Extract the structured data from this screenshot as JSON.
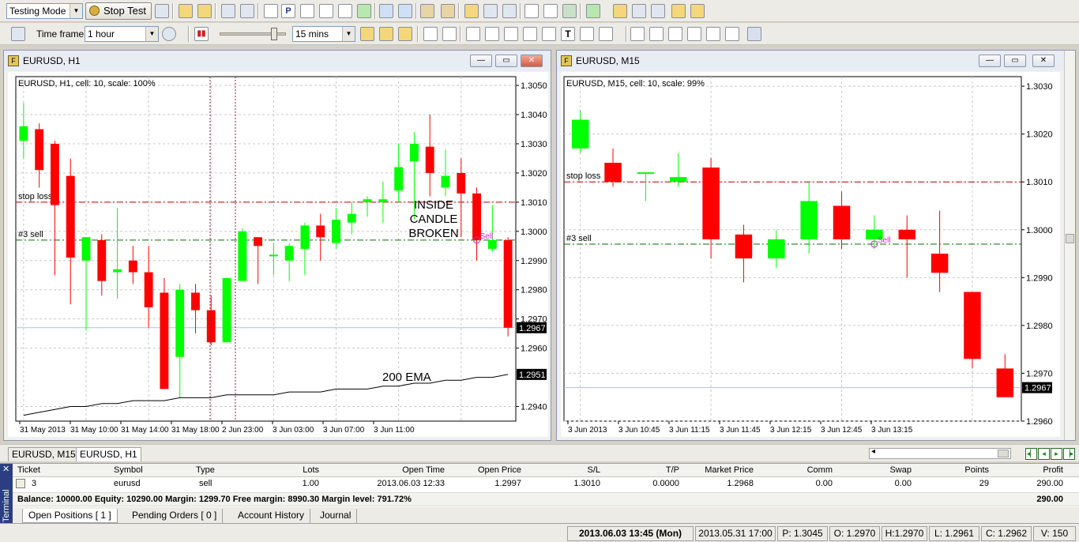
{
  "toolbar": {
    "mode_select": "Testing Mode",
    "stop_test_label": "Stop Test",
    "timeframe_label": "Time frame:",
    "timeframe_value": "1 hour",
    "speed_value": "15 mins"
  },
  "charts": [
    {
      "title": "EURUSD, H1",
      "info": "EURUSD, H1, cell: 10, scale: 100%",
      "y_ticks": [
        "1.3050",
        "1.3040",
        "1.3030",
        "1.3020",
        "1.3010",
        "1.3000",
        "1.2990",
        "1.2980",
        "1.2970",
        "1.2960",
        "1.2940"
      ],
      "x_ticks": [
        "31 May 2013",
        "31 May 10:00",
        "31 May 14:00",
        "31 May 18:00",
        "2 Jun 23:00",
        "3 Jun 03:00",
        "3 Jun 07:00",
        "3 Jun 11:00"
      ],
      "price_label": "1.2967",
      "ema_label": "1.2951",
      "stop_loss_label": "stop loss",
      "order_label": "#3 sell",
      "sell_marker": "Sell",
      "annotation_1": "INSIDE",
      "annotation_2": "CANDLE",
      "annotation_3": "BROKEN",
      "ema_text": "200 EMA"
    },
    {
      "title": "EURUSD, M15",
      "info": "EURUSD, M15, cell: 10, scale: 99%",
      "y_ticks": [
        "1.3030",
        "1.3020",
        "1.3010",
        "1.3000",
        "1.2990",
        "1.2980",
        "1.2970",
        "1.2960"
      ],
      "x_ticks": [
        "3 Jun 2013",
        "3 Jun 10:45",
        "3 Jun 11:15",
        "3 Jun 11:45",
        "3 Jun 12:15",
        "3 Jun 12:45",
        "3 Jun 13:15"
      ],
      "price_label": "1.2967",
      "stop_loss_label": "stop loss",
      "order_label": "#3 sell",
      "sell_marker": "Sell"
    }
  ],
  "chart_data": [
    {
      "type": "candlestick",
      "title": "EURUSD, H1",
      "ylim": [
        1.2935,
        1.3053
      ],
      "series": [
        {
          "name": "EURUSD H1",
          "candles": [
            [
              1.3031,
              1.3044,
              1.3025,
              1.3036
            ],
            [
              1.3035,
              1.3037,
              1.3015,
              1.3021
            ],
            [
              1.303,
              1.3031,
              1.2985,
              1.3009
            ],
            [
              1.3019,
              1.3025,
              1.2975,
              1.2991
            ],
            [
              1.299,
              1.2998,
              1.2966,
              1.2998
            ],
            [
              1.2997,
              1.2999,
              1.2978,
              1.2983
            ],
            [
              1.2986,
              1.3008,
              1.2977,
              1.2987
            ],
            [
              1.299,
              1.2995,
              1.2982,
              1.2986
            ],
            [
              1.2986,
              1.2995,
              1.2967,
              1.2974
            ],
            [
              1.2979,
              1.2984,
              1.296,
              1.2946
            ],
            [
              1.2957,
              1.2982,
              1.2943,
              1.298
            ],
            [
              1.2979,
              1.2982,
              1.2965,
              1.2973
            ],
            [
              1.2973,
              1.2978,
              1.2961,
              1.2962
            ],
            [
              1.2962,
              1.2982,
              1.2962,
              1.2984
            ],
            [
              1.2983,
              1.3001,
              1.2983,
              1.3
            ],
            [
              1.2998,
              1.2998,
              1.2982,
              1.2995
            ],
            [
              1.2992,
              1.2996,
              1.2985,
              1.2992
            ],
            [
              1.299,
              1.2996,
              1.2983,
              1.2995
            ],
            [
              1.2994,
              1.3003,
              1.2985,
              1.3002
            ],
            [
              1.3002,
              1.3006,
              1.299,
              1.2998
            ],
            [
              1.2996,
              1.3008,
              1.2994,
              1.3004
            ],
            [
              1.3003,
              1.301,
              1.2999,
              1.3006
            ],
            [
              1.301,
              1.3012,
              1.3005,
              1.3011
            ],
            [
              1.301,
              1.3017,
              1.3003,
              1.3011
            ],
            [
              1.3014,
              1.303,
              1.301,
              1.3022
            ],
            [
              1.3024,
              1.3034,
              1.3004,
              1.303
            ],
            [
              1.3029,
              1.304,
              1.3012,
              1.302
            ],
            [
              1.3015,
              1.3028,
              1.3012,
              1.3019
            ],
            [
              1.302,
              1.3025,
              1.2998,
              1.3013
            ],
            [
              1.3013,
              1.3015,
              1.299,
              1.2997
            ],
            [
              1.2994,
              1.3009,
              1.2993,
              1.2997
            ],
            [
              1.2997,
              1.2998,
              1.2964,
              1.2967
            ]
          ]
        }
      ],
      "ema": [
        1.2937,
        1.2938,
        1.2939,
        1.294,
        1.294,
        1.2941,
        1.2941,
        1.2942,
        1.2942,
        1.2942,
        1.2943,
        1.2943,
        1.2943,
        1.2944,
        1.2944,
        1.2944,
        1.2944,
        1.2945,
        1.2945,
        1.2945,
        1.2946,
        1.2946,
        1.2946,
        1.2947,
        1.2947,
        1.2948,
        1.2948,
        1.2949,
        1.2949,
        1.295,
        1.295,
        1.2951
      ],
      "stop_loss": 1.301,
      "order_price": 1.2997,
      "current_price": 1.2967
    },
    {
      "type": "candlestick",
      "title": "EURUSD, M15",
      "ylim": [
        1.296,
        1.3032
      ],
      "series": [
        {
          "name": "EURUSD M15",
          "candles": [
            [
              1.3017,
              1.3025,
              1.3016,
              1.3023
            ],
            [
              1.3014,
              1.3017,
              1.3009,
              1.301
            ],
            [
              1.3012,
              1.3012,
              1.3006,
              1.3012
            ],
            [
              1.301,
              1.3016,
              1.3009,
              1.3011
            ],
            [
              1.3013,
              1.3015,
              1.2994,
              1.2998
            ],
            [
              1.2999,
              1.3001,
              1.2989,
              1.2994
            ],
            [
              1.2994,
              1.3,
              1.2992,
              1.2998
            ],
            [
              1.2998,
              1.301,
              1.2995,
              1.3006
            ],
            [
              1.3005,
              1.3008,
              1.2996,
              1.2998
            ],
            [
              1.2998,
              1.3003,
              1.2996,
              1.3
            ],
            [
              1.3,
              1.3003,
              1.299,
              1.2998
            ],
            [
              1.2995,
              1.3004,
              1.2987,
              1.2991
            ],
            [
              1.2987,
              1.2987,
              1.2971,
              1.2973
            ],
            [
              1.2971,
              1.2974,
              1.2965,
              1.2965
            ]
          ]
        }
      ],
      "stop_loss": 1.301,
      "order_price": 1.2997,
      "current_price": 1.2967
    }
  ],
  "chart_tabs": [
    "EURUSD, M15",
    "EURUSD, H1"
  ],
  "terminal": {
    "side_label": "Terminal",
    "columns": [
      "Ticket",
      "Symbol",
      "Type",
      "Lots",
      "Open Time",
      "Open Price",
      "S/L",
      "T/P",
      "Market Price",
      "Comm",
      "Swap",
      "Points",
      "Profit"
    ],
    "row": [
      "3",
      "eurusd",
      "sell",
      "1.00",
      "2013.06.03 12:33",
      "1.2997",
      "1.3010",
      "0.0000",
      "1.2968",
      "0.00",
      "0.00",
      "29",
      "290.00"
    ],
    "balance": "Balance: 10000.00 Equity: 10290.00 Margin: 1299.70 Free margin: 8990.30 Margin level: 791.72%",
    "balance_profit": "290.00",
    "tabs": [
      "Open Positions  [ 1 ]",
      "Pending Orders  [ 0 ]",
      "Account History",
      "Journal"
    ]
  },
  "status": {
    "datetime": "2013.06.03 13:45 (Mon)",
    "bar_time": "2013.05.31 17:00",
    "p": "P: 1.3045",
    "o": "O: 1.2970",
    "h": "H:1.2970",
    "l": "L: 1.2961",
    "c": "C: 1.2962",
    "v": "V: 150"
  },
  "colors": {
    "bull": "#00ff00",
    "bear": "#ff0000",
    "stop_loss": "#c00000",
    "order": "#007000",
    "price_line": "#8fd0e0"
  }
}
